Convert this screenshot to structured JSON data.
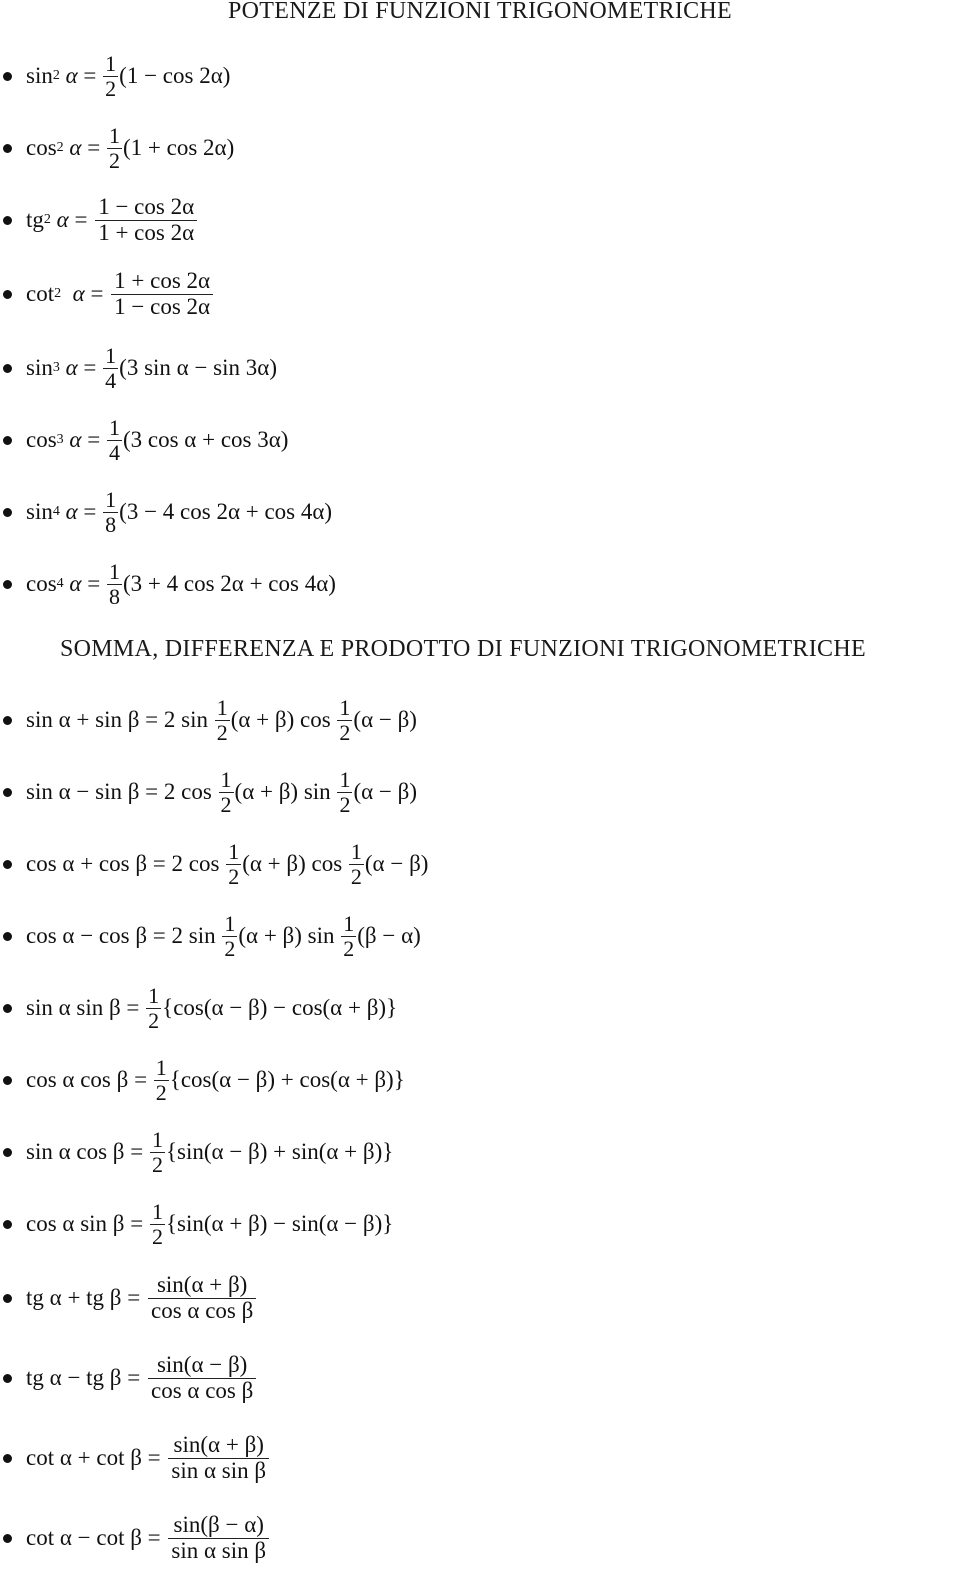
{
  "sections": [
    {
      "title": "POTENZE DI FUNZIONI TRIGONOMETRICHE",
      "formulas": [
        {
          "lhs": "sin",
          "exp": "2",
          "var": "α",
          "coef_num": "1",
          "coef_den": "2",
          "rhs": "(1 − cos 2α)"
        },
        {
          "lhs": "cos",
          "exp": "2",
          "var": "α",
          "coef_num": "1",
          "coef_den": "2",
          "rhs": "(1 + cos 2α)"
        },
        {
          "lhs": "tg",
          "exp": "2",
          "var": "α",
          "frac_num": "1 − cos 2α",
          "frac_den": "1 + cos 2α"
        },
        {
          "lhs": "cot",
          "exp": "2",
          "var": "α",
          "frac_num": "1 + cos 2α",
          "frac_den": "1 − cos 2α"
        },
        {
          "lhs": "sin",
          "exp": "3",
          "var": "α",
          "coef_num": "1",
          "coef_den": "4",
          "rhs": "(3 sin α − sin 3α)"
        },
        {
          "lhs": "cos",
          "exp": "3",
          "var": "α",
          "coef_num": "1",
          "coef_den": "4",
          "rhs": "(3 cos α + cos 3α)"
        },
        {
          "lhs": "sin",
          "exp": "4",
          "var": "α",
          "coef_num": "1",
          "coef_den": "8",
          "rhs": "(3 − 4 cos 2α + cos 4α)"
        },
        {
          "lhs": "cos",
          "exp": "4",
          "var": "α",
          "coef_num": "1",
          "coef_den": "8",
          "rhs": "(3 + 4 cos 2α + cos 4α)"
        }
      ]
    },
    {
      "title": "SOMMA, DIFFERENZA E PRODOTTO DI FUNZIONI TRIGONOMETRICHE",
      "formulas": [
        {
          "lhs": "sin α + sin β = 2 sin ",
          "f1": "1",
          "d1": "2",
          "mid": "(α + β) cos ",
          "f2": "1",
          "d2": "2",
          "end": "(α − β)"
        },
        {
          "lhs": "sin α − sin β = 2 cos ",
          "f1": "1",
          "d1": "2",
          "mid": "(α + β) sin ",
          "f2": "1",
          "d2": "2",
          "end": "(α − β)"
        },
        {
          "lhs": "cos α + cos β = 2 cos ",
          "f1": "1",
          "d1": "2",
          "mid": "(α + β) cos ",
          "f2": "1",
          "d2": "2",
          "end": "(α − β)"
        },
        {
          "lhs": "cos α − cos β = 2 sin ",
          "f1": "1",
          "d1": "2",
          "mid": "(α + β) sin ",
          "f2": "1",
          "d2": "2",
          "end": "(β − α)"
        },
        {
          "lhs": "sin α sin β = ",
          "f1": "1",
          "d1": "2",
          "end": "{cos(α − β) − cos(α + β)}"
        },
        {
          "lhs": "cos α cos β = ",
          "f1": "1",
          "d1": "2",
          "end": "{cos(α − β) + cos(α + β)}"
        },
        {
          "lhs": "sin α cos β = ",
          "f1": "1",
          "d1": "2",
          "end": "{sin(α − β) + sin(α + β)}"
        },
        {
          "lhs": "cos α sin β = ",
          "f1": "1",
          "d1": "2",
          "end": "{sin(α + β) − sin(α − β)}"
        },
        {
          "lhs": "tg α + tg β = ",
          "fn": "sin(α + β)",
          "fd": "cos α cos β"
        },
        {
          "lhs": "tg α − tg β = ",
          "fn": "sin(α − β)",
          "fd": "cos α cos β"
        },
        {
          "lhs": "cot α + cot β = ",
          "fn": "sin(α + β)",
          "fd": "sin α sin β"
        },
        {
          "lhs": "cot α − cot β = ",
          "fn": "sin(β − α)",
          "fd": "sin α sin β"
        }
      ]
    }
  ],
  "symbols": {
    "equals": " = ",
    "bullet": "bullet-icon"
  }
}
